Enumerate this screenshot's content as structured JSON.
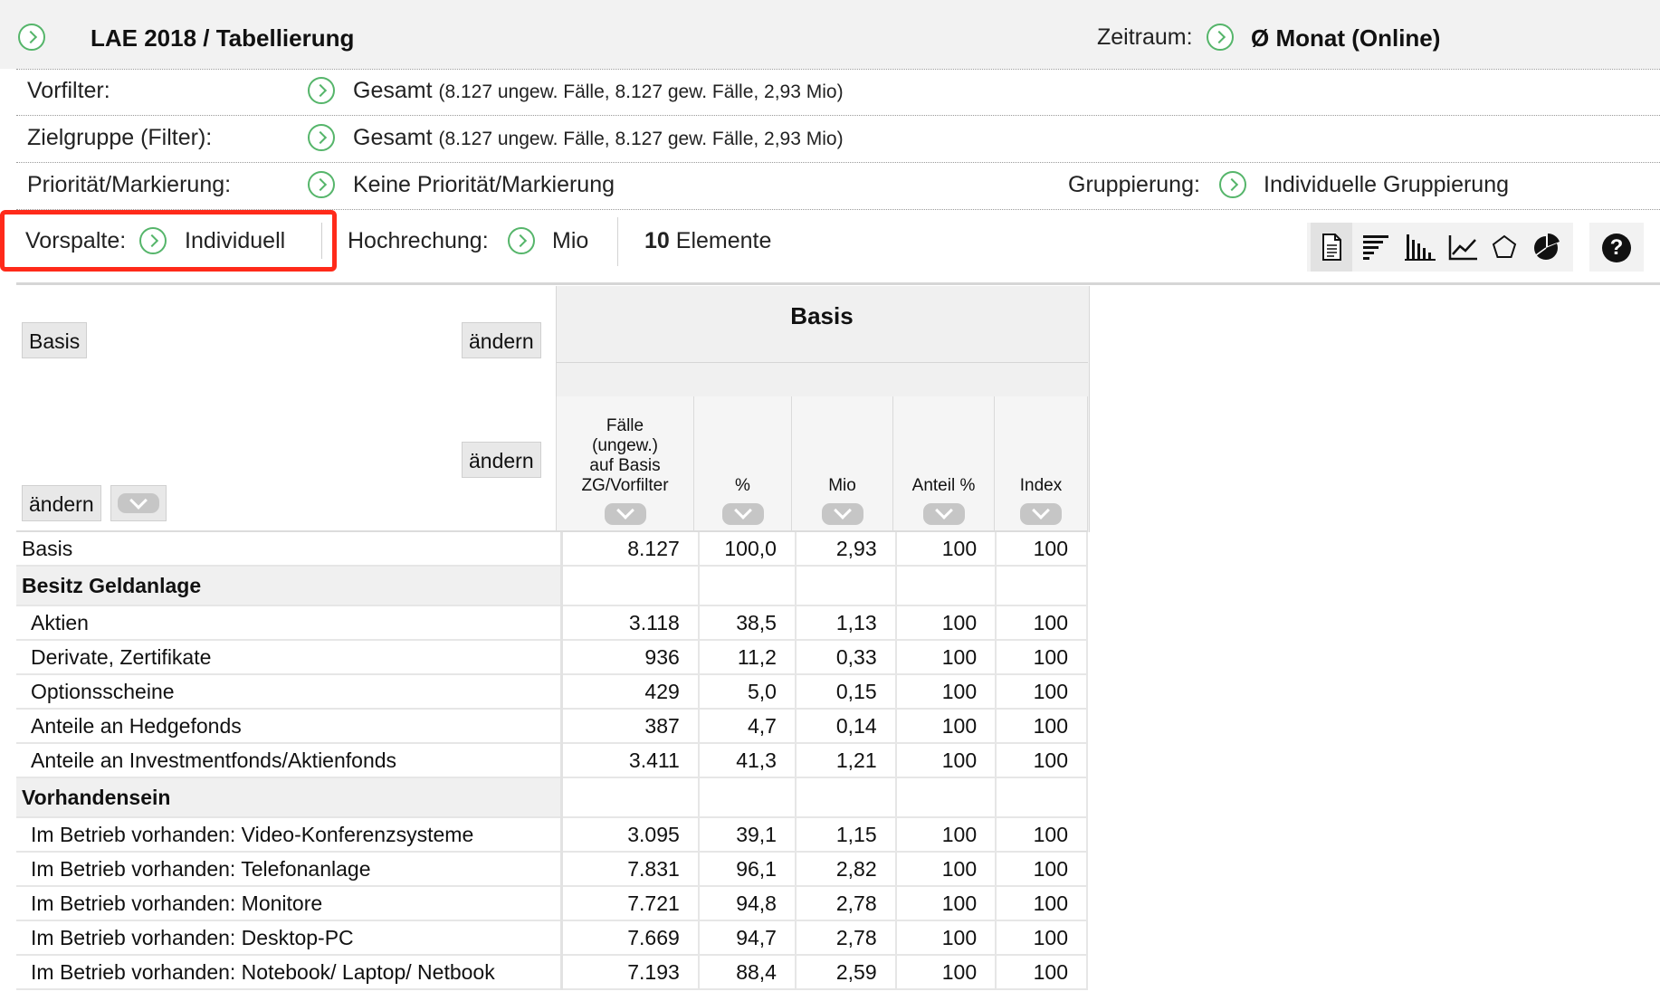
{
  "header": {
    "title": "LAE 2018 / Tabellierung",
    "zeitraum_label": "Zeitraum:",
    "zeitraum_value": "Ø Monat (Online)"
  },
  "filters": {
    "vorfilter_label": "Vorfilter:",
    "vorfilter_value": "Gesamt",
    "vorfilter_detail": "(8.127 ungew. Fälle, 8.127 gew. Fälle, 2,93 Mio)",
    "zielgruppe_label": "Zielgruppe (Filter):",
    "zielgruppe_value": "Gesamt",
    "zielgruppe_detail": "(8.127 ungew. Fälle, 8.127 gew. Fälle, 2,93 Mio)",
    "prioritaet_label": "Priorität/Markierung:",
    "prioritaet_value": "Keine Priorität/Markierung",
    "gruppierung_label": "Gruppierung:",
    "gruppierung_value": "Individuelle Gruppierung"
  },
  "toolbar": {
    "vorspalte_label": "Vorspalte:",
    "vorspalte_value": "Individuell",
    "hochrechnung_label": "Hochrechung:",
    "hochrechnung_value": "Mio",
    "elemente_count": "10",
    "elemente_label": "Elemente",
    "highlight_color": "#ff2a1a",
    "icons": [
      "document-icon",
      "bar-horizontal-icon",
      "bar-vertical-icon",
      "line-chart-icon",
      "pentagon-icon",
      "pie-chart-icon",
      "help-icon"
    ]
  },
  "left_panel": {
    "basis_label": "Basis",
    "andern1": "ändern",
    "andern2": "ändern",
    "andern3": "ändern"
  },
  "table": {
    "top_header": "Basis",
    "columns": [
      "Fälle (ungew.) auf Basis ZG/Vorfilter",
      "%",
      "Mio",
      "Anteil %",
      "Index"
    ],
    "col1_lines": [
      "Fälle",
      "(ungew.)",
      "auf Basis",
      "ZG/Vorfilter"
    ],
    "rows": [
      {
        "label": "Basis",
        "type": "plain",
        "values": [
          "8.127",
          "100,0",
          "2,93",
          "100",
          "100"
        ]
      },
      {
        "label": "Besitz Geldanlage",
        "type": "group",
        "values": [
          "",
          "",
          "",
          "",
          ""
        ]
      },
      {
        "label": "Aktien",
        "type": "sub",
        "values": [
          "3.118",
          "38,5",
          "1,13",
          "100",
          "100"
        ]
      },
      {
        "label": "Derivate, Zertifikate",
        "type": "sub",
        "values": [
          "936",
          "11,2",
          "0,33",
          "100",
          "100"
        ]
      },
      {
        "label": "Optionsscheine",
        "type": "sub",
        "values": [
          "429",
          "5,0",
          "0,15",
          "100",
          "100"
        ]
      },
      {
        "label": "Anteile an Hedgefonds",
        "type": "sub",
        "values": [
          "387",
          "4,7",
          "0,14",
          "100",
          "100"
        ]
      },
      {
        "label": "Anteile an Investmentfonds/Aktienfonds",
        "type": "sub",
        "values": [
          "3.411",
          "41,3",
          "1,21",
          "100",
          "100"
        ]
      },
      {
        "label": "Vorhandensein",
        "type": "group",
        "values": [
          "",
          "",
          "",
          "",
          ""
        ]
      },
      {
        "label": "Im Betrieb vorhanden: Video-Konferenzsysteme",
        "type": "sub",
        "values": [
          "3.095",
          "39,1",
          "1,15",
          "100",
          "100"
        ]
      },
      {
        "label": "Im Betrieb vorhanden: Telefonanlage",
        "type": "sub",
        "values": [
          "7.831",
          "96,1",
          "2,82",
          "100",
          "100"
        ]
      },
      {
        "label": "Im Betrieb vorhanden: Monitore",
        "type": "sub",
        "values": [
          "7.721",
          "94,8",
          "2,78",
          "100",
          "100"
        ]
      },
      {
        "label": "Im Betrieb vorhanden: Desktop-PC",
        "type": "sub",
        "values": [
          "7.669",
          "94,7",
          "2,78",
          "100",
          "100"
        ]
      },
      {
        "label": "Im Betrieb vorhanden: Notebook/ Laptop/ Netbook",
        "type": "sub",
        "values": [
          "7.193",
          "88,4",
          "2,59",
          "100",
          "100"
        ]
      }
    ]
  }
}
